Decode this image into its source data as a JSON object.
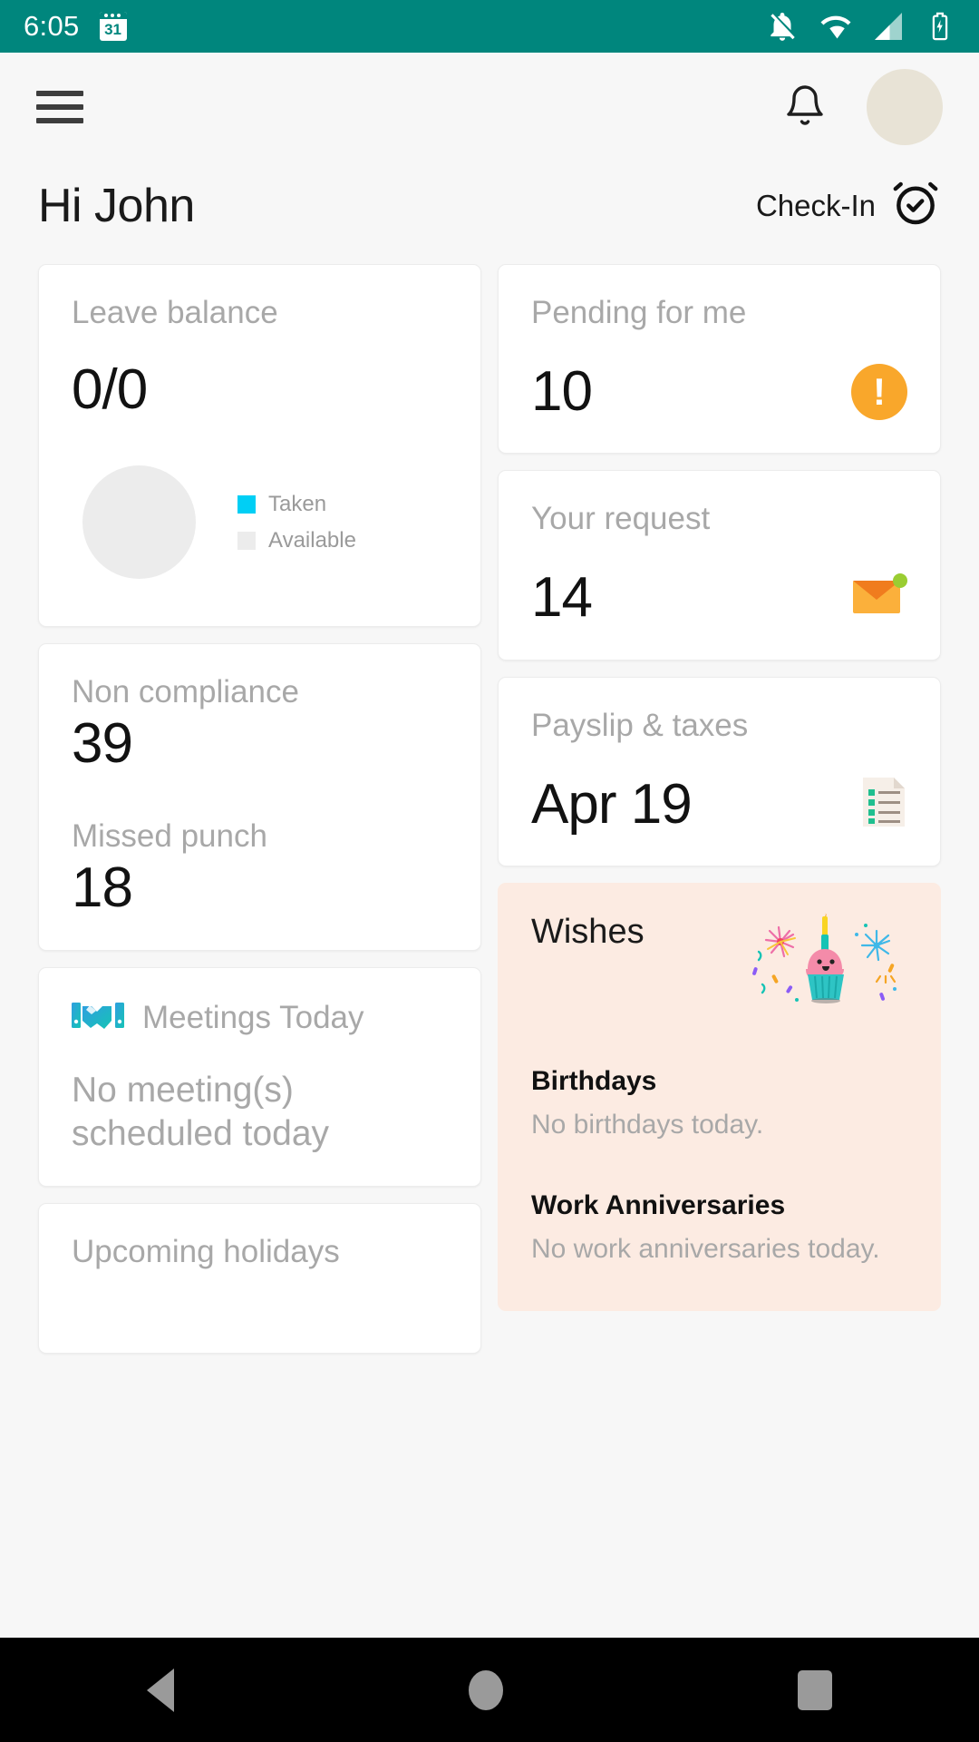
{
  "status_bar": {
    "time": "6:05",
    "calendar_day": "31",
    "background_color": "#00867D",
    "icons": [
      "notifications-off-icon",
      "wifi-icon",
      "signal-icon",
      "battery-charging-icon"
    ]
  },
  "app_bar": {
    "menu_icon": "hamburger-menu-icon",
    "notification_icon": "bell-icon",
    "avatar": "user-avatar"
  },
  "greeting": {
    "title": "Hi John",
    "checkin_label": "Check-In",
    "checkin_icon": "alarm-check-icon"
  },
  "cards": {
    "leave_balance": {
      "title": "Leave balance",
      "value": "0/0",
      "legend": [
        {
          "label": "Taken",
          "color": "#00CFF5"
        },
        {
          "label": "Available",
          "color": "#ECECEC"
        }
      ]
    },
    "non_compliance": {
      "title": "Non compliance",
      "value": "39",
      "second_title": "Missed punch",
      "second_value": "18"
    },
    "meetings": {
      "icon": "handshake-icon",
      "title": "Meetings Today",
      "body": "No meeting(s) scheduled today"
    },
    "holidays": {
      "title": "Upcoming holidays"
    },
    "pending": {
      "title": "Pending for me",
      "value": "10",
      "icon": "warning-exclamation-icon",
      "icon_color": "#F9A72B"
    },
    "your_request": {
      "title": "Your request",
      "value": "14",
      "icon": "envelope-icon",
      "icon_color": "#F9A72B"
    },
    "payslip": {
      "title": "Payslip & taxes",
      "value": "Apr 19",
      "icon": "receipt-list-icon"
    },
    "wishes": {
      "title": "Wishes",
      "icon": "birthday-cupcake-icon",
      "background_color": "#FCEBE2",
      "birthdays_title": "Birthdays",
      "birthdays_body": "No birthdays today.",
      "anniversaries_title": "Work Anniversaries",
      "anniversaries_body": "No work anniversaries today."
    }
  },
  "nav_bar": {
    "back": "back-button",
    "home": "home-button",
    "recents": "recents-button"
  }
}
